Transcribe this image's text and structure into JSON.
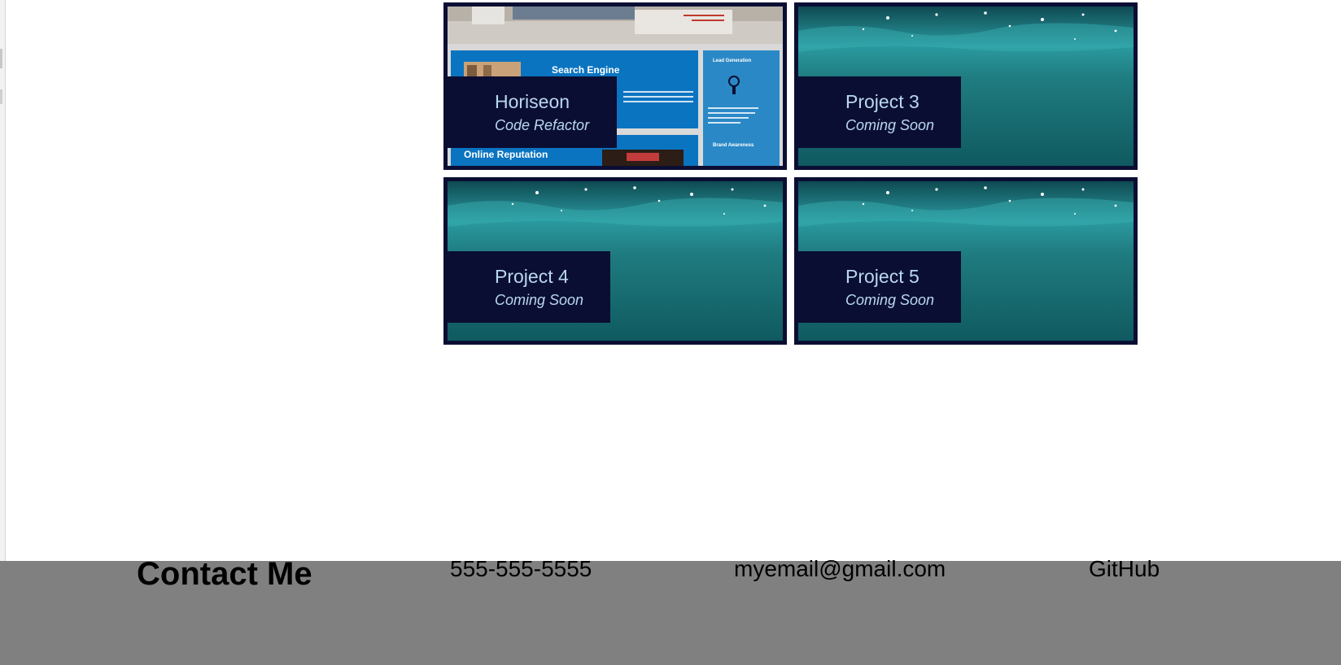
{
  "projects": [
    {
      "title": "Horiseon",
      "subtitle": "Code Refactor",
      "screenshot": {
        "search": "Search Engine",
        "lead": "Lead Generation",
        "online": "Online Reputation",
        "brand": "Brand Awareness"
      }
    },
    {
      "title": "Project 3",
      "subtitle": "Coming Soon"
    },
    {
      "title": "Project 4",
      "subtitle": "Coming Soon"
    },
    {
      "title": "Project 5",
      "subtitle": "Coming Soon"
    }
  ],
  "footer": {
    "heading": "Contact Me",
    "phone": "555-555-5555",
    "email": "myemail@gmail.com",
    "github": "GitHub"
  },
  "colors": {
    "card_border": "#0b0e33",
    "caption_text": "#b9d8ef",
    "footer_bg": "#808080",
    "water": "#1a6f74"
  }
}
